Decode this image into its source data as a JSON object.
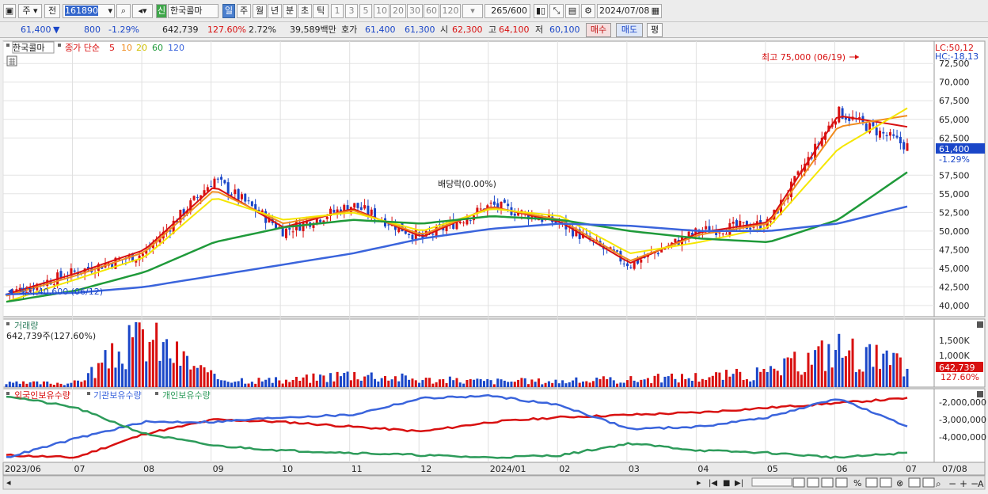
{
  "toolbar": {
    "market_type": "주",
    "chart_sel": "전",
    "stock_code": "161890",
    "stock_name": "한국콜마",
    "badge": "신",
    "periods": [
      "일",
      "주",
      "월",
      "년",
      "분",
      "초",
      "틱"
    ],
    "active_period": "일",
    "minute_steps": [
      "1",
      "3",
      "5",
      "10",
      "20",
      "30",
      "60",
      "120"
    ],
    "count": "265",
    "count_total": "/600",
    "date": "2024/07/08"
  },
  "quote": {
    "price": "61,400",
    "direction": "▼",
    "change": "800",
    "change_pct": "-1.29%",
    "volume": "642,739",
    "volume_ratio": "127.60%",
    "turnover": "2.72%",
    "amount": "39,589백만",
    "ask_label": "호가",
    "ask": "61,400",
    "bid": "61,300",
    "open_label": "시",
    "open": "62,300",
    "high_label": "고",
    "high": "64,100",
    "low_label": "저",
    "low": "60,100",
    "buy_button": "매수",
    "sell_button": "매도",
    "avg_button": "평"
  },
  "legend": {
    "name": "한국콜마",
    "close_label": "종가 단순",
    "ma_periods": [
      "5",
      "10",
      "20",
      "60",
      "120"
    ]
  },
  "annotations": {
    "high_text": "최고 75,000 (06/19)",
    "low_text": "최저 40,600 (06/12)",
    "dividend_text": "배당락(0.00%)",
    "lc": "LC:50,12",
    "hc": "HC:-18,13"
  },
  "price_axis": [
    "72,500",
    "70,000",
    "67,500",
    "65,000",
    "62,500",
    "57,500",
    "55,000",
    "52,500",
    "50,000",
    "47,500",
    "45,000",
    "42,500",
    "40,000"
  ],
  "current_price_box": "61,400",
  "current_pct": "-1.29%",
  "volume_panel": {
    "title": "거래량",
    "value_label": "642,739주(127.60%)",
    "axis": [
      "1,500K",
      "1,000K"
    ],
    "current_box": "642,739",
    "current_pct": "127.60%"
  },
  "holdings_panel": {
    "series_labels": [
      "외국인보유수량",
      "기관보유수량",
      "개인보유수량"
    ],
    "axis": [
      "-2,000,000",
      "-3,000,000",
      "-4,000,000"
    ]
  },
  "x_labels": [
    "2023/06",
    "07",
    "08",
    "09",
    "10",
    "11",
    "12",
    "2024/01",
    "02",
    "03",
    "04",
    "05",
    "06",
    "07",
    "07/08"
  ],
  "colors": {
    "up": "#d81010",
    "down": "#1a46c8",
    "ma5": "#d81010",
    "ma10": "#f08c1e",
    "ma20": "#f5e600",
    "ma60": "#1f9a3a",
    "ma120": "#3a64dc",
    "foreign": "#d81010",
    "institution": "#3a64dc",
    "individual": "#2d9b5a",
    "highlight_box": "#1a46c8"
  },
  "chart_data": [
    {
      "type": "candlestick",
      "title": "한국콜마",
      "x": [
        "2023/06",
        "07",
        "08",
        "09",
        "10",
        "11",
        "12",
        "2024/01",
        "02",
        "03",
        "04",
        "05",
        "06",
        "07"
      ],
      "series": [
        {
          "name": "종가",
          "values": [
            41500,
            44500,
            47000,
            57000,
            50000,
            53500,
            49000,
            53500,
            51000,
            45500,
            50000,
            51000,
            66000,
            61400
          ]
        },
        {
          "name": "5",
          "values": [
            41500,
            44300,
            47500,
            56000,
            50500,
            53000,
            49200,
            53300,
            51200,
            45700,
            49800,
            51200,
            65500,
            64000
          ]
        },
        {
          "name": "10",
          "values": [
            41300,
            44000,
            47200,
            55500,
            51000,
            52800,
            49500,
            53200,
            51500,
            46000,
            49500,
            51000,
            64000,
            65500
          ]
        },
        {
          "name": "20",
          "values": [
            40500,
            43500,
            46500,
            54500,
            51500,
            52500,
            50000,
            53000,
            52000,
            47000,
            48500,
            50500,
            61000,
            66500
          ]
        },
        {
          "name": "60",
          "values": [
            40500,
            42000,
            44500,
            48500,
            50500,
            51500,
            51000,
            52000,
            51500,
            50000,
            49000,
            48500,
            51500,
            57900
          ]
        },
        {
          "name": "120",
          "values": [
            41500,
            41700,
            42500,
            44000,
            45500,
            47000,
            49000,
            50300,
            51000,
            50700,
            50000,
            50000,
            51000,
            53300
          ]
        }
      ],
      "ylim": [
        38500,
        75500
      ]
    },
    {
      "type": "bar",
      "title": "거래량",
      "x": [
        "2023/06",
        "07",
        "08",
        "09",
        "10",
        "11",
        "12",
        "2024/01",
        "02",
        "03",
        "04",
        "05",
        "06",
        "07"
      ],
      "values": [
        120,
        150,
        1700,
        300,
        200,
        450,
        250,
        200,
        200,
        250,
        350,
        450,
        1300,
        642.739
      ],
      "ylim": [
        0,
        1800
      ]
    },
    {
      "type": "line",
      "x": [
        "2023/06",
        "07",
        "08",
        "09",
        "10",
        "11",
        "12",
        "2024/01",
        "02",
        "03",
        "04",
        "05",
        "06",
        "07"
      ],
      "series": [
        {
          "name": "외국인보유수량",
          "values": [
            -4.4,
            -4.5,
            -3.5,
            -2.9,
            -3.0,
            -3.2,
            -3.4,
            -3.0,
            -2.8,
            -2.7,
            -2.6,
            -2.4,
            -2.2,
            -2.0
          ]
        },
        {
          "name": "기관보유수량",
          "values": [
            -4.5,
            -3.7,
            -3.0,
            -3.0,
            -2.8,
            -2.7,
            -2.0,
            -1.9,
            -2.3,
            -3.3,
            -3.2,
            -2.8,
            -2.0,
            -3.2
          ]
        },
        {
          "name": "개인보유수량",
          "values": [
            -1.9,
            -2.4,
            -3.5,
            -4.0,
            -4.2,
            -4.3,
            -4.4,
            -4.5,
            -4.4,
            -3.9,
            -4.2,
            -4.3,
            -4.5,
            -4.3
          ]
        }
      ],
      "ylim": [
        -4.7,
        -1.6
      ]
    }
  ]
}
